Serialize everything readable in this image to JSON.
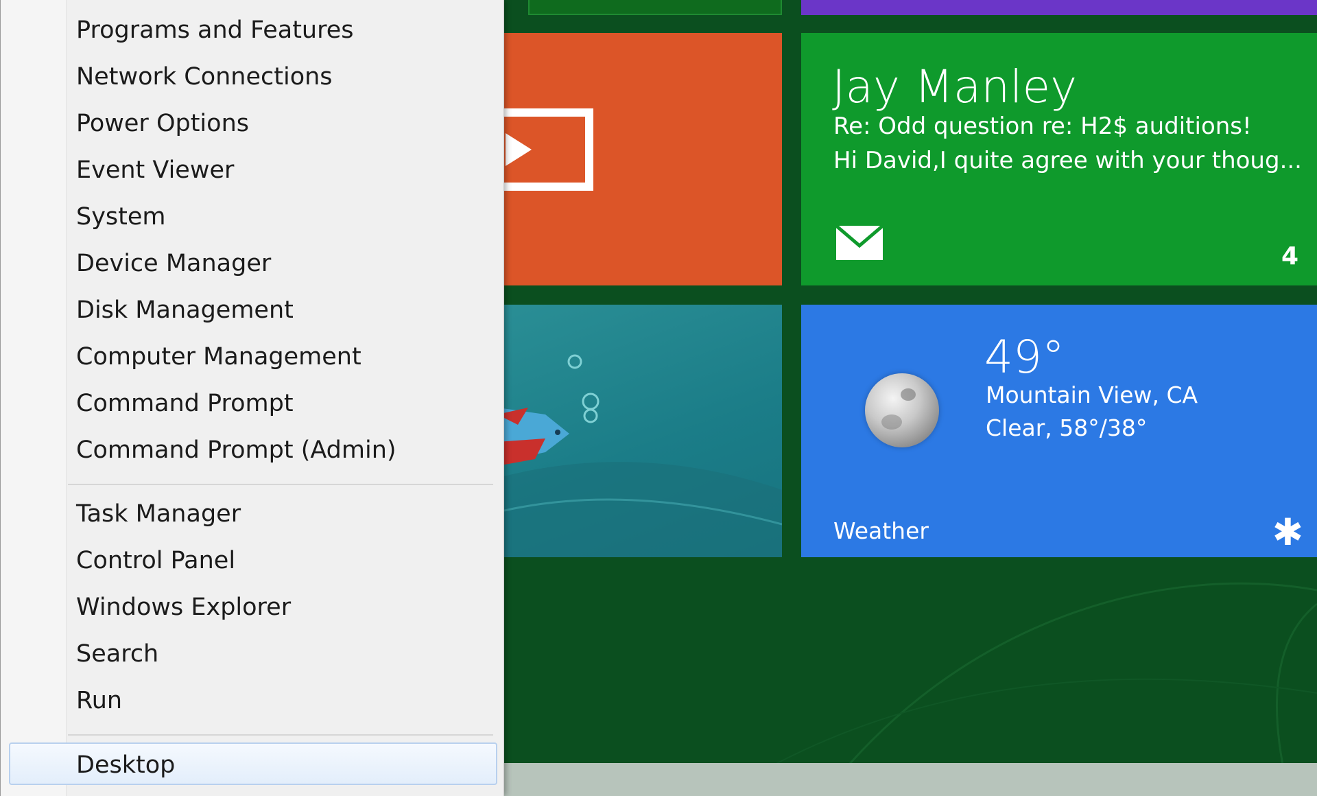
{
  "menu": {
    "items": [
      "Programs and Features",
      "Network Connections",
      "Power Options",
      "Event Viewer",
      "System",
      "Device Manager",
      "Disk Management",
      "Computer Management",
      "Command Prompt",
      "Command Prompt (Admin)",
      "Task Manager",
      "Control Panel",
      "Windows Explorer",
      "Search",
      "Run",
      "Desktop"
    ],
    "highlighted": "Desktop"
  },
  "tiles": {
    "mail": {
      "sender": "Jay Manley",
      "subject": "Re: Odd question re: H2$ auditions!",
      "preview": "Hi David,I quite agree with your thoug...",
      "count": "4",
      "icon": "envelope-icon",
      "color": "#0f9a2c"
    },
    "weather": {
      "temperature": "49°",
      "location": "Mountain View, CA",
      "condition": "Clear, 58°/38°",
      "app_name": "Weather",
      "icon": "moon-icon",
      "app_icon": "sun-icon",
      "color": "#2c79e4"
    },
    "video": {
      "icon": "play-icon",
      "color": "#dc5528"
    },
    "photo": {
      "color": "#1b7d88"
    }
  },
  "colors": {
    "start_background": "#0b4f1f",
    "menu_background": "#f0f0f0",
    "menu_highlight_border": "#b8d0ee"
  }
}
